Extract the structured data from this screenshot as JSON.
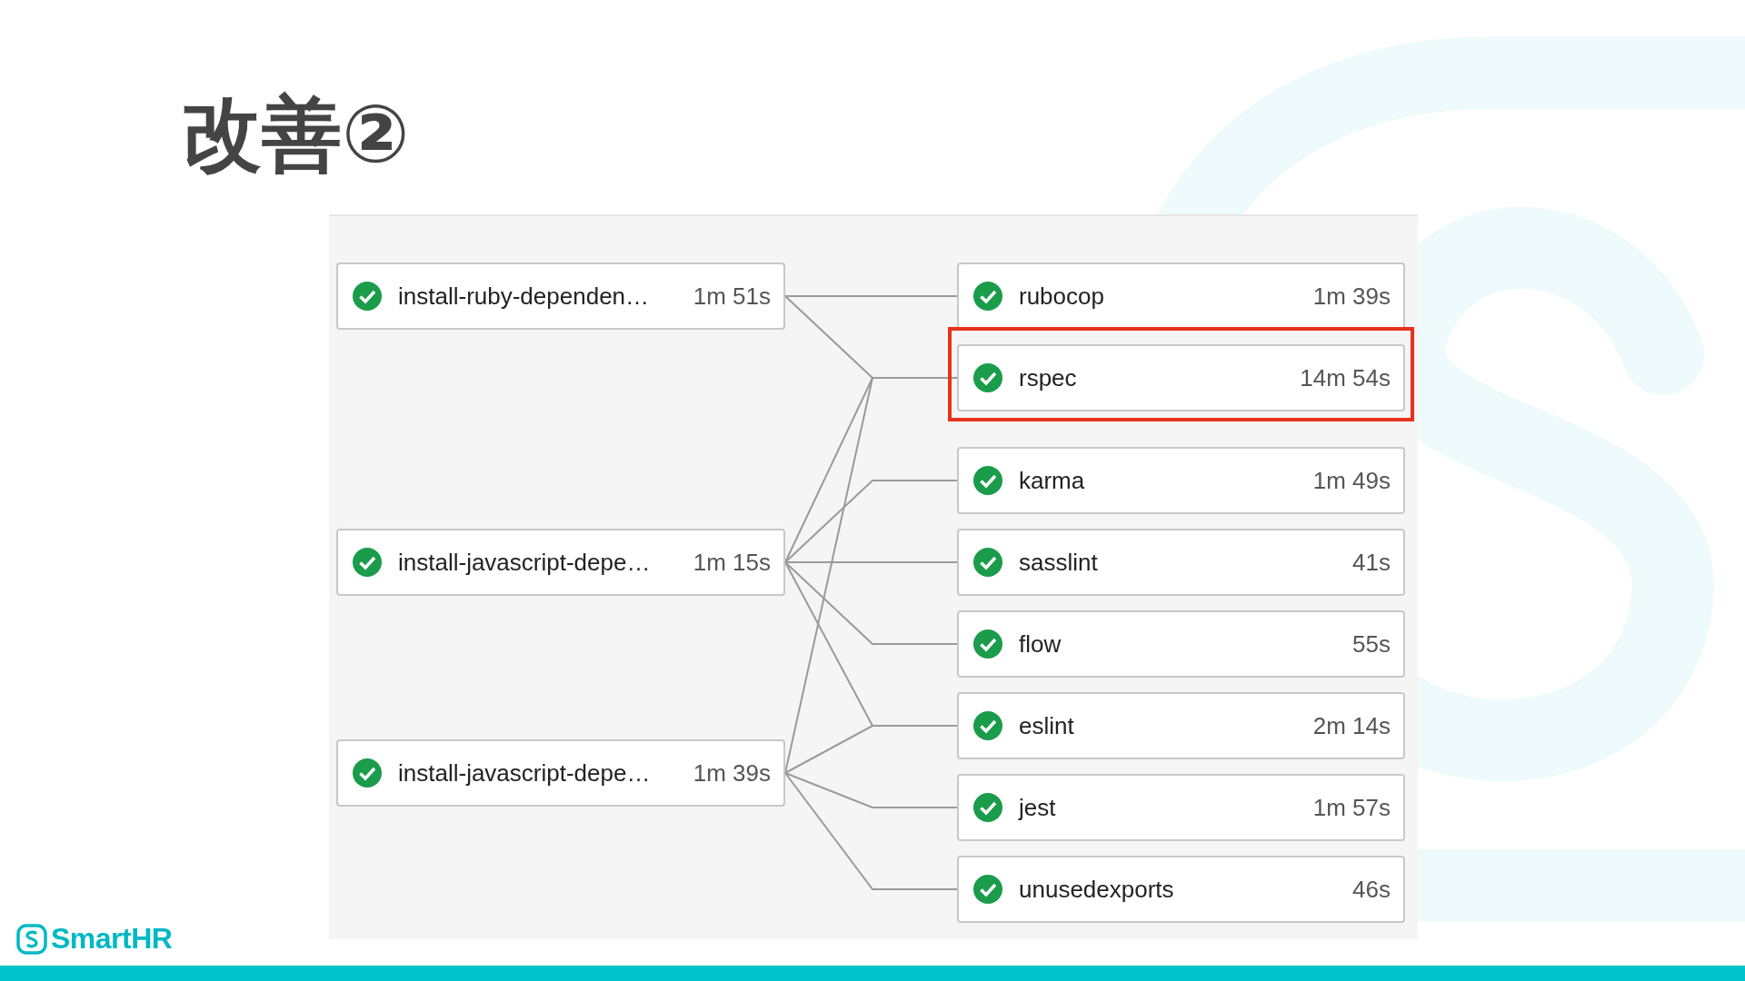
{
  "title": "改善②",
  "upstream_jobs": [
    {
      "name": "install-ruby-dependen…",
      "duration": "1m 51s",
      "passed": true
    },
    {
      "name": "install-javascript-depe…",
      "duration": "1m 15s",
      "passed": true
    },
    {
      "name": "install-javascript-depe…",
      "duration": "1m 39s",
      "passed": true
    }
  ],
  "downstream_jobs": [
    {
      "name": "rubocop",
      "duration": "1m 39s",
      "passed": true,
      "highlighted": false
    },
    {
      "name": "rspec",
      "duration": "14m 54s",
      "passed": true,
      "highlighted": true
    },
    {
      "name": "karma",
      "duration": "1m 49s",
      "passed": true,
      "highlighted": false
    },
    {
      "name": "sasslint",
      "duration": "41s",
      "passed": true,
      "highlighted": false
    },
    {
      "name": "flow",
      "duration": "55s",
      "passed": true,
      "highlighted": false
    },
    {
      "name": "eslint",
      "duration": "2m 14s",
      "passed": true,
      "highlighted": false
    },
    {
      "name": "jest",
      "duration": "1m 57s",
      "passed": true,
      "highlighted": false
    },
    {
      "name": "unusedexports",
      "duration": "46s",
      "passed": true,
      "highlighted": false
    }
  ],
  "logo": {
    "text": "SmartHR"
  }
}
